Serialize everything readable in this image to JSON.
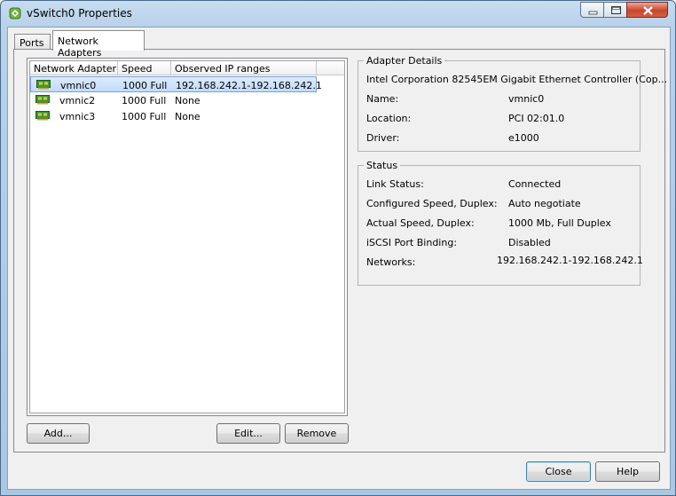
{
  "window": {
    "title": "vSwitch0 Properties",
    "icon": "vsphere-switch-icon"
  },
  "tabs": [
    {
      "label": "Ports"
    },
    {
      "label": "Network Adapters"
    }
  ],
  "adapter_list": {
    "columns": [
      "Network Adapter",
      "Speed",
      "Observed IP ranges"
    ],
    "rows": [
      {
        "name": "vmnic0",
        "speed": "1000 Full",
        "ip": "192.168.242.1-192.168.242.1",
        "selected": true
      },
      {
        "name": "vmnic2",
        "speed": "1000 Full",
        "ip": "None"
      },
      {
        "name": "vmnic3",
        "speed": "1000 Full",
        "ip": "None"
      }
    ]
  },
  "list_buttons": {
    "add": "Add...",
    "edit": "Edit...",
    "remove": "Remove"
  },
  "adapter_details": {
    "title": "Adapter Details",
    "description": "Intel Corporation 82545EM Gigabit Ethernet Controller (Cop...",
    "name_label": "Name:",
    "name_value": "vmnic0",
    "location_label": "Location:",
    "location_value": "PCI 02:01.0",
    "driver_label": "Driver:",
    "driver_value": "e1000"
  },
  "status": {
    "title": "Status",
    "link_label": "Link Status:",
    "link_value": "Connected",
    "configured_label": "Configured Speed, Duplex:",
    "configured_value": "Auto negotiate",
    "actual_label": "Actual Speed, Duplex:",
    "actual_value": "1000 Mb, Full Duplex",
    "iscsi_label": "iSCSI Port Binding:",
    "iscsi_value": "Disabled",
    "networks_label": "Networks:",
    "networks_value": "192.168.242.1-192.168.242.1"
  },
  "footer": {
    "close": "Close",
    "help": "Help"
  }
}
